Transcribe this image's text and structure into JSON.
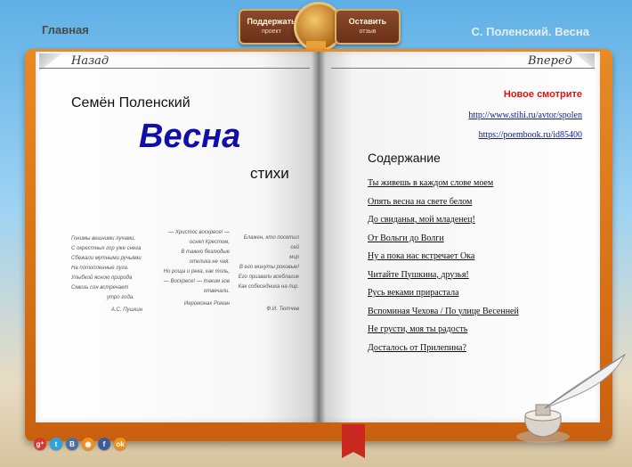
{
  "header": {
    "home_link": "Главная",
    "book_title": "С. Поленский. Весна",
    "support_button": {
      "label": "Поддержать",
      "sublabel": "проект"
    },
    "review_button": {
      "label": "Оставить",
      "sublabel": "отзыв"
    }
  },
  "nav": {
    "back": "Назад",
    "forward": "Вперед"
  },
  "left_page": {
    "author": "Семён Поленский",
    "title": "Весна",
    "subtitle": "стихи",
    "epigraphs": [
      {
        "lines": [
          "Гонимы вешними лучами,",
          "С окрестных гор уже снега",
          "Сбежали мутными ручьями",
          "На потопленные луга.",
          "Улыбкой ясною природа",
          "Сквозь сон встречает",
          "утро года."
        ],
        "signature": "А.С. Пушкин"
      },
      {
        "lines": [
          "— Христос воскресе! —",
          "оснял Крестом,",
          "В тажно безлюдые",
          "отклика не чая.",
          "Но роща и река, как толь,",
          "— Воскресе! — таким зов",
          "отвечали."
        ],
        "signature": "Иеромонах Роман"
      },
      {
        "lines": [
          "Блажен, кто посетил сей",
          "мир",
          "В его минуты роковые!",
          "Его призвали всеблагие",
          "Как собеседника на пир."
        ],
        "signature": "Ф.И. Тютчев"
      }
    ]
  },
  "right_page": {
    "new_label": "Новое смотрите",
    "links": [
      "http://www.stihi.ru/avtor/spolen",
      "https://poembook.ru/id85400"
    ],
    "contents_title": "Содержание",
    "toc": [
      "Ты живешь в каждом слове моем",
      "Опять весна на свете белом",
      "До свиданья, мой младенец!",
      "От Вольги до Волги",
      "Ну а пока нас встречает Ока",
      "Читайте Пушкина, друзья!",
      "Русь веками прирастала",
      "Вспоминая Чехова / По улице Весенней",
      "Не грусти, моя ты радость",
      "Досталось от Прилепина?"
    ]
  },
  "social": [
    {
      "icon": "google-plus-icon",
      "glyph": "g⁺",
      "color": "#d23b2e"
    },
    {
      "icon": "twitter-icon",
      "glyph": "t",
      "color": "#2fa3dd"
    },
    {
      "icon": "vk-icon",
      "glyph": "В",
      "color": "#4a6fa5"
    },
    {
      "icon": "rss-icon",
      "glyph": "◉",
      "color": "#f0901c"
    },
    {
      "icon": "facebook-icon",
      "glyph": "f",
      "color": "#3b5b9a"
    },
    {
      "icon": "odnoklassniki-icon",
      "glyph": "ok",
      "color": "#f0901c"
    }
  ]
}
